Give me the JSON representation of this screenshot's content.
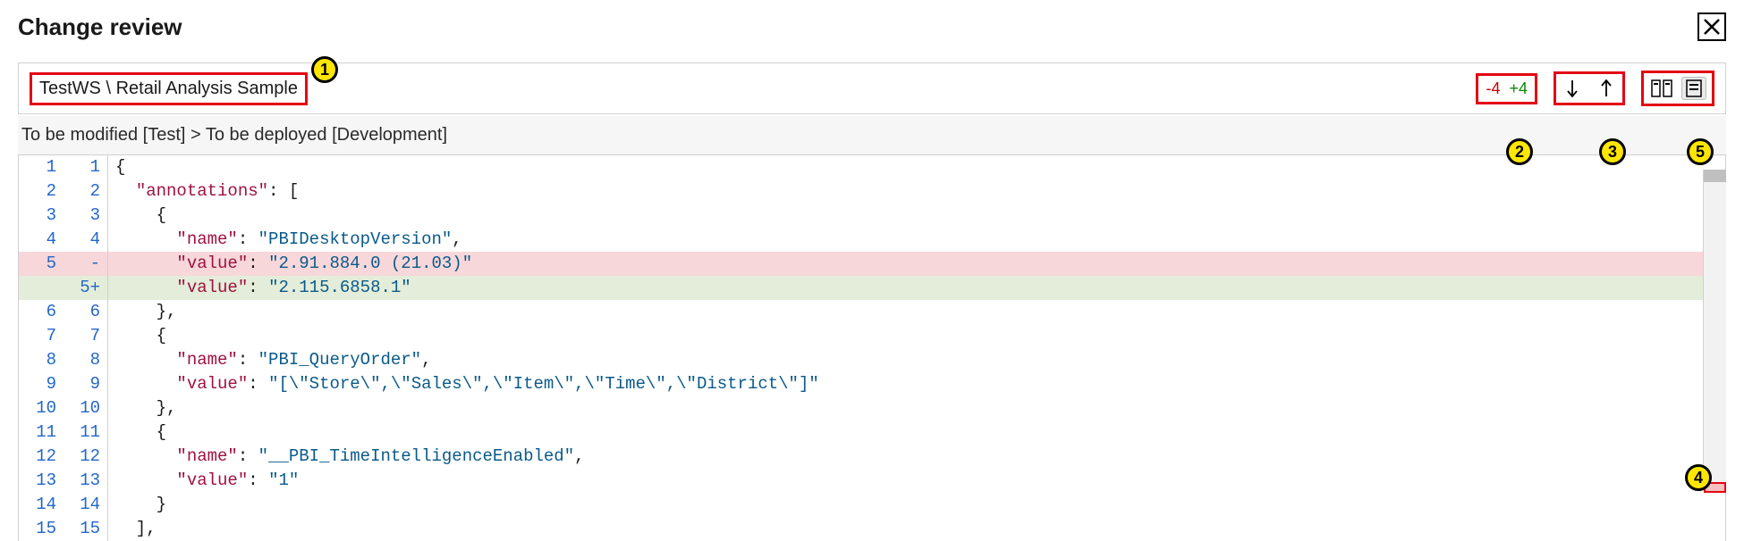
{
  "title": "Change review",
  "breadcrumb": "TestWS \\ Retail Analysis Sample",
  "stats": {
    "removed": "-4",
    "added": "+4"
  },
  "subheader": "To be modified [Test] > To be deployed [Development]",
  "markers": {
    "m1": "1",
    "m2": "2",
    "m3": "3",
    "m4": "4",
    "m5": "5"
  },
  "code": {
    "lines": [
      {
        "l": "1",
        "r": "1",
        "marker": "",
        "cls": "",
        "tokens": [
          {
            "t": "{",
            "c": "tok-punc"
          }
        ]
      },
      {
        "l": "2",
        "r": "2",
        "marker": "",
        "cls": "",
        "tokens": [
          {
            "t": "  ",
            "c": ""
          },
          {
            "t": "\"annotations\"",
            "c": "tok-keyname"
          },
          {
            "t": ": [",
            "c": "tok-punc"
          }
        ]
      },
      {
        "l": "3",
        "r": "3",
        "marker": "",
        "cls": "",
        "tokens": [
          {
            "t": "    {",
            "c": "tok-punc"
          }
        ]
      },
      {
        "l": "4",
        "r": "4",
        "marker": "",
        "cls": "",
        "tokens": [
          {
            "t": "      ",
            "c": ""
          },
          {
            "t": "\"name\"",
            "c": "tok-keyname"
          },
          {
            "t": ": ",
            "c": "tok-punc"
          },
          {
            "t": "\"PBIDesktopVersion\"",
            "c": "tok-str"
          },
          {
            "t": ",",
            "c": "tok-punc"
          }
        ]
      },
      {
        "l": "5",
        "r": "",
        "marker": "-",
        "cls": "removed",
        "tokens": [
          {
            "t": "      ",
            "c": ""
          },
          {
            "t": "\"value\"",
            "c": "tok-keyname"
          },
          {
            "t": ": ",
            "c": "tok-punc"
          },
          {
            "t": "\"2.91.884.0 (21.03)\"",
            "c": "tok-str"
          }
        ]
      },
      {
        "l": "",
        "r": "5",
        "marker": "+",
        "cls": "added",
        "tokens": [
          {
            "t": "      ",
            "c": ""
          },
          {
            "t": "\"value\"",
            "c": "tok-keyname"
          },
          {
            "t": ": ",
            "c": "tok-punc"
          },
          {
            "t": "\"2.115.6858.1\"",
            "c": "tok-str"
          }
        ]
      },
      {
        "l": "6",
        "r": "6",
        "marker": "",
        "cls": "",
        "tokens": [
          {
            "t": "    },",
            "c": "tok-punc"
          }
        ]
      },
      {
        "l": "7",
        "r": "7",
        "marker": "",
        "cls": "",
        "tokens": [
          {
            "t": "    {",
            "c": "tok-punc"
          }
        ]
      },
      {
        "l": "8",
        "r": "8",
        "marker": "",
        "cls": "",
        "tokens": [
          {
            "t": "      ",
            "c": ""
          },
          {
            "t": "\"name\"",
            "c": "tok-keyname"
          },
          {
            "t": ": ",
            "c": "tok-punc"
          },
          {
            "t": "\"PBI_QueryOrder\"",
            "c": "tok-str"
          },
          {
            "t": ",",
            "c": "tok-punc"
          }
        ]
      },
      {
        "l": "9",
        "r": "9",
        "marker": "",
        "cls": "",
        "tokens": [
          {
            "t": "      ",
            "c": ""
          },
          {
            "t": "\"value\"",
            "c": "tok-keyname"
          },
          {
            "t": ": ",
            "c": "tok-punc"
          },
          {
            "t": "\"[\\\"Store\\\",\\\"Sales\\\",\\\"Item\\\",\\\"Time\\\",\\\"District\\\"]\"",
            "c": "tok-str"
          }
        ]
      },
      {
        "l": "10",
        "r": "10",
        "marker": "",
        "cls": "",
        "tokens": [
          {
            "t": "    },",
            "c": "tok-punc"
          }
        ]
      },
      {
        "l": "11",
        "r": "11",
        "marker": "",
        "cls": "",
        "tokens": [
          {
            "t": "    {",
            "c": "tok-punc"
          }
        ]
      },
      {
        "l": "12",
        "r": "12",
        "marker": "",
        "cls": "",
        "tokens": [
          {
            "t": "      ",
            "c": ""
          },
          {
            "t": "\"name\"",
            "c": "tok-keyname"
          },
          {
            "t": ": ",
            "c": "tok-punc"
          },
          {
            "t": "\"__PBI_TimeIntelligenceEnabled\"",
            "c": "tok-str"
          },
          {
            "t": ",",
            "c": "tok-punc"
          }
        ]
      },
      {
        "l": "13",
        "r": "13",
        "marker": "",
        "cls": "",
        "tokens": [
          {
            "t": "      ",
            "c": ""
          },
          {
            "t": "\"value\"",
            "c": "tok-keyname"
          },
          {
            "t": ": ",
            "c": "tok-punc"
          },
          {
            "t": "\"1\"",
            "c": "tok-str"
          }
        ]
      },
      {
        "l": "14",
        "r": "14",
        "marker": "",
        "cls": "",
        "tokens": [
          {
            "t": "    }",
            "c": "tok-punc"
          }
        ]
      },
      {
        "l": "15",
        "r": "15",
        "marker": "",
        "cls": "",
        "tokens": [
          {
            "t": "  ],",
            "c": "tok-punc"
          }
        ]
      }
    ]
  }
}
